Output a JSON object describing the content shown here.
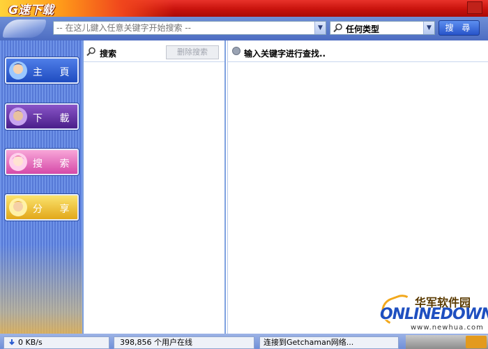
{
  "app": {
    "title": "G速下载"
  },
  "search": {
    "placeholder": "-- 在这儿鍵入任意关键字开始搜索 --",
    "type_selected": "任何类型",
    "button_label": "搜 尋"
  },
  "sidebar": {
    "items": [
      {
        "label": "主 頁",
        "icon": "user-avatar-icon"
      },
      {
        "label": "下 載",
        "icon": "user-avatar-icon"
      },
      {
        "label": "搜 索",
        "icon": "user-avatar-icon"
      },
      {
        "label": "分 享",
        "icon": "user-avatar-icon"
      }
    ]
  },
  "middle_panel": {
    "title": "搜索",
    "clear_button": "删除搜索"
  },
  "right_panel": {
    "title": "输入关键字进行查找.."
  },
  "status": {
    "speed": "0 KB/s",
    "users": "398,856 个用户在线",
    "connection": "连接到Getchaman网络..."
  },
  "watermark": {
    "cn": "华军软件园",
    "logo": "ONLINEDOWN",
    "url": "www.newhua.com"
  },
  "colors": {
    "titlebar": "#c8120c",
    "accent_blue": "#4d6dc2",
    "sidebar_bg": "#6f93e8"
  }
}
